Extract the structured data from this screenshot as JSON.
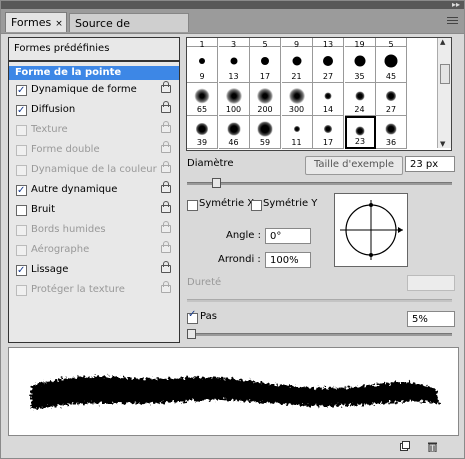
{
  "tabs": [
    {
      "label": "Formes",
      "close": "×"
    },
    {
      "label": "Source de duplication"
    }
  ],
  "topbar": {
    "collapse": "▸▸"
  },
  "left": {
    "header": "Formes prédéfinies",
    "selected": "Forme de la pointe",
    "items": [
      {
        "label": "Dynamique de forme",
        "checked": true,
        "enabled": true
      },
      {
        "label": "Diffusion",
        "checked": true,
        "enabled": true
      },
      {
        "label": "Texture",
        "checked": false,
        "enabled": false
      },
      {
        "label": "Forme double",
        "checked": false,
        "enabled": false
      },
      {
        "label": "Dynamique de la couleur",
        "checked": false,
        "enabled": false
      },
      {
        "label": "Autre dynamique",
        "checked": true,
        "enabled": true
      },
      {
        "label": "Bruit",
        "checked": false,
        "enabled": true
      },
      {
        "label": "Bords humides",
        "checked": false,
        "enabled": false
      },
      {
        "label": "Aérographe",
        "checked": false,
        "enabled": false
      },
      {
        "label": "Lissage",
        "checked": true,
        "enabled": true
      },
      {
        "label": "Protéger la texture",
        "checked": false,
        "enabled": false
      }
    ]
  },
  "brushes": [
    [
      "1",
      "3",
      "5",
      "9",
      "13",
      "19",
      "5"
    ],
    [
      "9",
      "13",
      "17",
      "21",
      "27",
      "35",
      "45"
    ],
    [
      "65",
      "100",
      "200",
      "300",
      "14",
      "24",
      "27"
    ],
    [
      "39",
      "46",
      "59",
      "11",
      "17",
      "23",
      "36"
    ]
  ],
  "scroll": {
    "up": "▲",
    "down": "▼"
  },
  "diameter": {
    "label": "Diamètre",
    "button": "Taille d'exemple",
    "value": "23 px"
  },
  "flip": {
    "x": "Symétrie X",
    "y": "Symétrie Y"
  },
  "angle": {
    "label": "Angle :",
    "value": "0°"
  },
  "roundness": {
    "label": "Arrondi :",
    "value": "100%"
  },
  "hardness": {
    "label": "Dureté"
  },
  "spacing": {
    "label": "Pas",
    "value": "5%",
    "checked": true
  }
}
